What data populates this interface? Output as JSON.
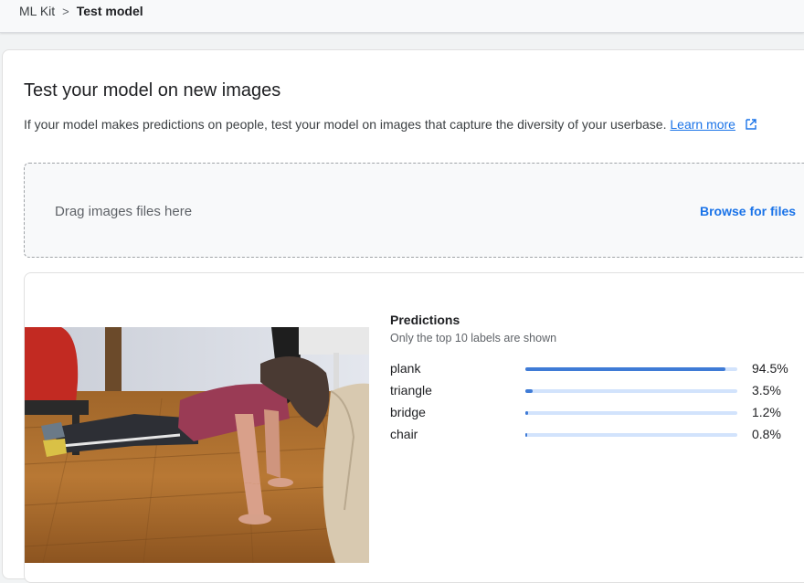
{
  "breadcrumb": {
    "root": "ML Kit",
    "separator": ">",
    "current": "Test model"
  },
  "section": {
    "title": "Test your model on new images",
    "description": "If your model makes predictions on people, test your model on images that capture the diversity of your userbase.",
    "learn_more": "Learn more"
  },
  "dropzone": {
    "text": "Drag images files here",
    "browse": "Browse for files"
  },
  "predictions": {
    "title": "Predictions",
    "subtitle": "Only the top 10 labels are shown",
    "items": [
      {
        "label": "plank",
        "value": "94.5%",
        "fraction": 0.945
      },
      {
        "label": "triangle",
        "value": "3.5%",
        "fraction": 0.035
      },
      {
        "label": "bridge",
        "value": "1.2%",
        "fraction": 0.012
      },
      {
        "label": "chair",
        "value": "0.8%",
        "fraction": 0.008
      }
    ]
  },
  "colors": {
    "accent": "#1a73e8",
    "bar_fill": "#3f7bd6",
    "bar_track": "#d2e3fc"
  },
  "icons": {
    "external_link": "open-in-new-icon"
  }
}
